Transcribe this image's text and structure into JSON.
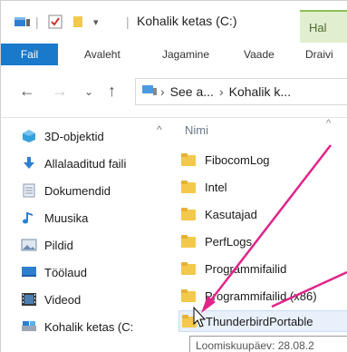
{
  "window": {
    "title": "Kohalik ketas (C:)",
    "manage_tab": "Hal"
  },
  "ribbon": {
    "tabs": [
      "Fail",
      "Avaleht",
      "Jagamine",
      "Vaade",
      "Draivi"
    ]
  },
  "address": {
    "segments": [
      "See a...",
      "Kohalik k..."
    ]
  },
  "navpane": {
    "items": [
      {
        "label": "3D-objektid",
        "icon": "3d-objects-icon"
      },
      {
        "label": "Allalaaditud faili",
        "icon": "downloads-icon"
      },
      {
        "label": "Dokumendid",
        "icon": "documents-icon"
      },
      {
        "label": "Muusika",
        "icon": "music-icon"
      },
      {
        "label": "Pildid",
        "icon": "pictures-icon"
      },
      {
        "label": "Töölaud",
        "icon": "desktop-icon"
      },
      {
        "label": "Videod",
        "icon": "videos-icon"
      },
      {
        "label": "Kohalik ketas (C:",
        "icon": "drive-icon"
      }
    ]
  },
  "content": {
    "column_header": "Nimi",
    "folders": [
      "FibocomLog",
      "Intel",
      "Kasutajad",
      "PerfLogs",
      "Programmifailid",
      "Programmifailid (x86)",
      "ThunderbirdPortable"
    ],
    "tooltip": "Loomiskuupäev: 28.08.2"
  },
  "colors": {
    "accent": "#1979ca",
    "manage": "#8cc152",
    "arrow": "#e0248a",
    "folder": "#f2c94c"
  }
}
